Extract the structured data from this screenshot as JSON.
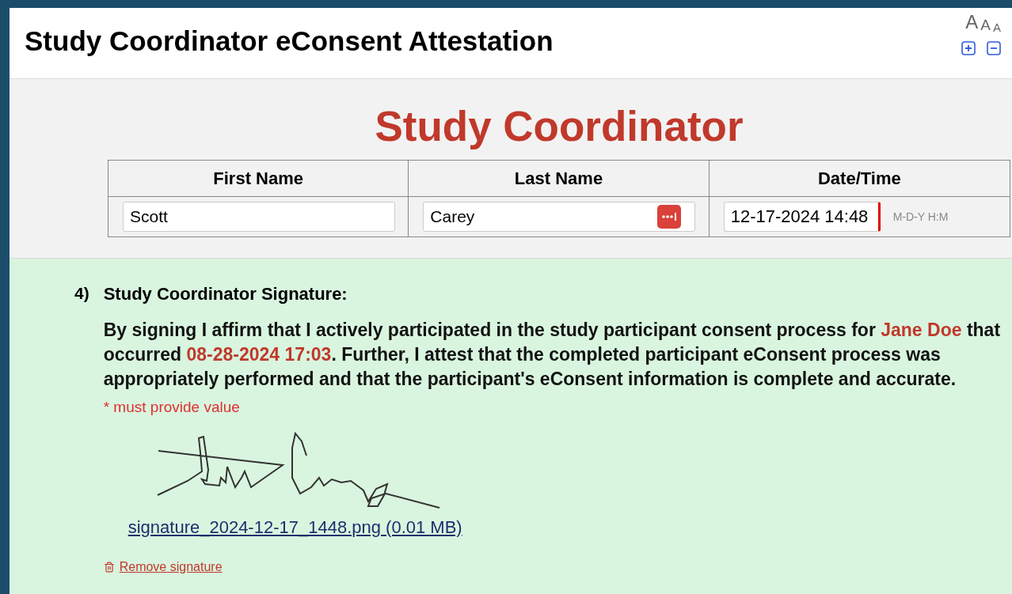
{
  "header": {
    "title": "Study Coordinator eConsent Attestation",
    "font_size_labels": [
      "A",
      "A",
      "A"
    ]
  },
  "section": {
    "heading": "Study Coordinator",
    "columns": [
      "First Name",
      "Last Name",
      "Date/Time"
    ],
    "fields": [
      {
        "kind": "text",
        "value": "Scott"
      },
      {
        "kind": "password",
        "value": "Carey"
      },
      {
        "kind": "datetime",
        "value": "12-17-2024 14:48",
        "hint": "M-D-Y H:M"
      }
    ]
  },
  "question": {
    "number": "4)",
    "label": "Study Coordinator Signature:",
    "statement": [
      {
        "kind": "plain",
        "text": "By signing I affirm that I actively participated in the study participant consent process for "
      },
      {
        "kind": "highlight",
        "text": "Jane Doe"
      },
      {
        "kind": "plain",
        "text": " that occurred "
      },
      {
        "kind": "highlight",
        "text": "08-28-2024 17:03"
      },
      {
        "kind": "plain",
        "text": ". Further, I attest that the completed participant eConsent process was appropriately performed and that the participant's eConsent information is complete and accurate."
      }
    ],
    "required_note": "* must provide value",
    "file_link": "signature_2024-12-17_1448.png (0.01 MB)",
    "remove_link": "Remove signature"
  }
}
